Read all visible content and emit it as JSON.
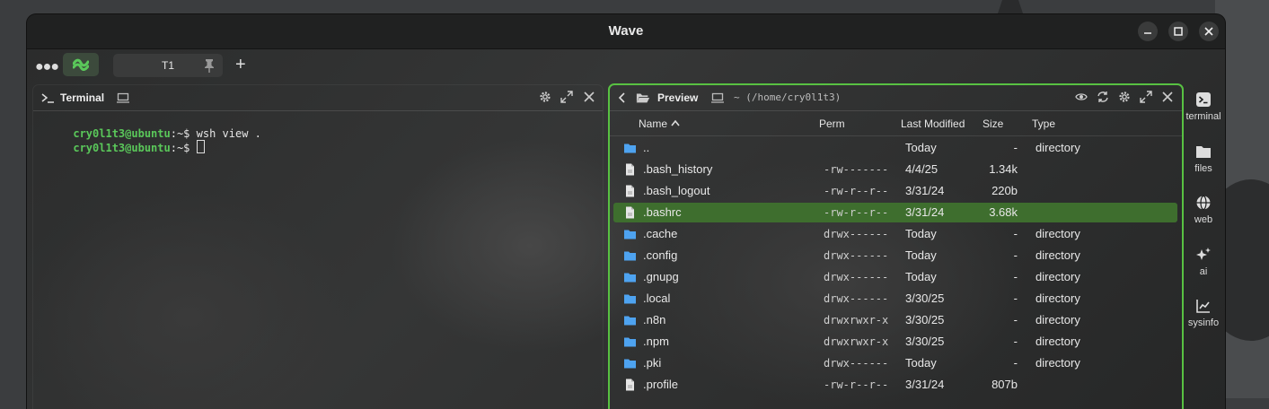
{
  "window": {
    "title": "Wave"
  },
  "tabbar": {
    "tabs": [
      {
        "label": "T1"
      }
    ],
    "add_label": "+"
  },
  "terminal": {
    "title": "Terminal",
    "lines": [
      {
        "user": "cry0l1t3@ubuntu",
        "rest": ":~$ wsh view ."
      },
      {
        "user": "cry0l1t3@ubuntu",
        "rest": ":~$ "
      }
    ]
  },
  "preview": {
    "title": "Preview",
    "path": "~ (/home/cry0l1t3)",
    "columns": {
      "name": "Name",
      "perm": "Perm",
      "modified": "Last Modified",
      "size": "Size",
      "type": "Type"
    },
    "rows": [
      {
        "name": "..",
        "perm": "",
        "modified": "Today",
        "size": "-",
        "type": "directory",
        "icon": "folder-icon"
      },
      {
        "name": ".bash_history",
        "perm": "-rw-------",
        "modified": "4/4/25",
        "size": "1.34k",
        "type": "",
        "icon": "file-icon"
      },
      {
        "name": ".bash_logout",
        "perm": "-rw-r--r--",
        "modified": "3/31/24",
        "size": "220b",
        "type": "",
        "icon": "file-icon"
      },
      {
        "name": ".bashrc",
        "perm": "-rw-r--r--",
        "modified": "3/31/24",
        "size": "3.68k",
        "type": "",
        "icon": "file-icon",
        "selected": true
      },
      {
        "name": ".cache",
        "perm": "drwx------",
        "modified": "Today",
        "size": "-",
        "type": "directory",
        "icon": "folder-icon"
      },
      {
        "name": ".config",
        "perm": "drwx------",
        "modified": "Today",
        "size": "-",
        "type": "directory",
        "icon": "folder-icon"
      },
      {
        "name": ".gnupg",
        "perm": "drwx------",
        "modified": "Today",
        "size": "-",
        "type": "directory",
        "icon": "folder-icon"
      },
      {
        "name": ".local",
        "perm": "drwx------",
        "modified": "3/30/25",
        "size": "-",
        "type": "directory",
        "icon": "folder-icon"
      },
      {
        "name": ".n8n",
        "perm": "drwxrwxr-x",
        "modified": "3/30/25",
        "size": "-",
        "type": "directory",
        "icon": "folder-icon"
      },
      {
        "name": ".npm",
        "perm": "drwxrwxr-x",
        "modified": "3/30/25",
        "size": "-",
        "type": "directory",
        "icon": "folder-icon"
      },
      {
        "name": ".pki",
        "perm": "drwx------",
        "modified": "Today",
        "size": "-",
        "type": "directory",
        "icon": "folder-icon"
      },
      {
        "name": ".profile",
        "perm": "-rw-r--r--",
        "modified": "3/31/24",
        "size": "807b",
        "type": "",
        "icon": "file-icon"
      }
    ]
  },
  "sidebar": {
    "items": [
      {
        "label": "terminal",
        "icon": "terminal-icon"
      },
      {
        "label": "files",
        "icon": "folder-icon"
      },
      {
        "label": "web",
        "icon": "globe-icon"
      },
      {
        "label": "ai",
        "icon": "sparkles-icon"
      },
      {
        "label": "sysinfo",
        "icon": "chart-icon"
      }
    ]
  },
  "colors": {
    "accent": "#58c142",
    "selected_row": "#3e6e2e",
    "folder": "#4ea3f0",
    "user": "#5ac85a"
  }
}
